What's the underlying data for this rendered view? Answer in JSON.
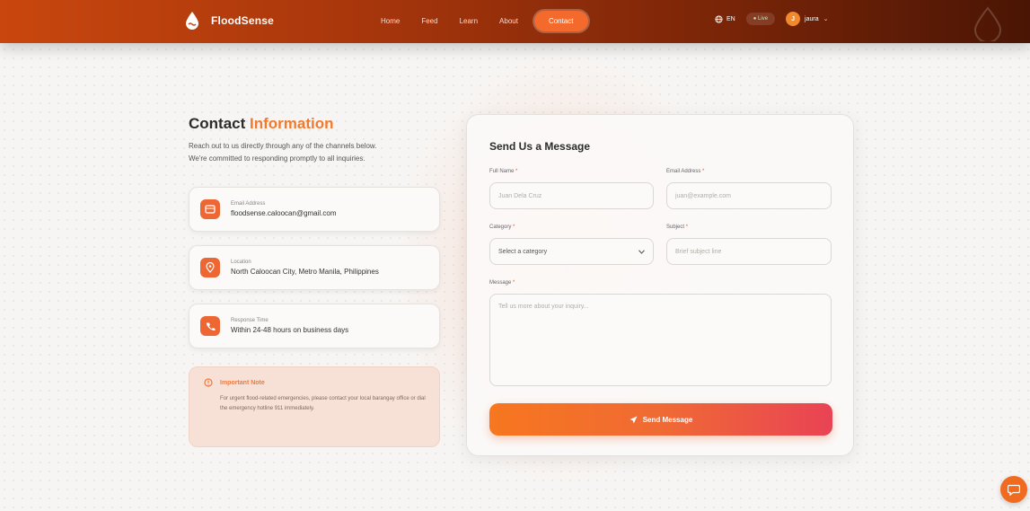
{
  "header": {
    "brand": "FloodSense",
    "nav": [
      "Home",
      "Feed",
      "Learn",
      "About",
      "Contact"
    ],
    "active_nav": "Contact",
    "language": "EN",
    "live_label": "Live",
    "user_initial": "J",
    "user_name": "jaura"
  },
  "contact_info": {
    "title_part1": "Contact",
    "title_part2": "Information",
    "intro_line1": "Reach out to us directly through any of the channels below.",
    "intro_line2": "We're committed to responding promptly to all inquiries.",
    "email_label": "Email Address",
    "email_value": "floodsense.caloocan@gmail.com",
    "location_label": "Location",
    "location_value": "North Caloocan City, Metro Manila, Philippines",
    "response_label": "Response Time",
    "response_value": "Within 24-48 hours on business days",
    "note_title": "Important Note",
    "note_text": "For urgent flood-related emergencies, please contact your local barangay office or dial the emergency hotline 911 immediately."
  },
  "form": {
    "title": "Send Us a Message",
    "full_name_label": "Full Name",
    "full_name_placeholder": "Juan Dela Cruz",
    "email_label": "Email Address",
    "email_placeholder": "juan@example.com",
    "category_label": "Category",
    "category_value": "Select a category",
    "subject_label": "Subject",
    "subject_placeholder": "Brief subject line",
    "message_label": "Message",
    "message_placeholder": "Tell us more about your inquiry...",
    "required_mark": "*",
    "send_label": "Send Message"
  },
  "colors": {
    "accent": "#f07a2d",
    "header_start": "#c9470e",
    "header_end": "#4a1504",
    "button_start": "#f7761f",
    "button_end": "#e94355"
  }
}
